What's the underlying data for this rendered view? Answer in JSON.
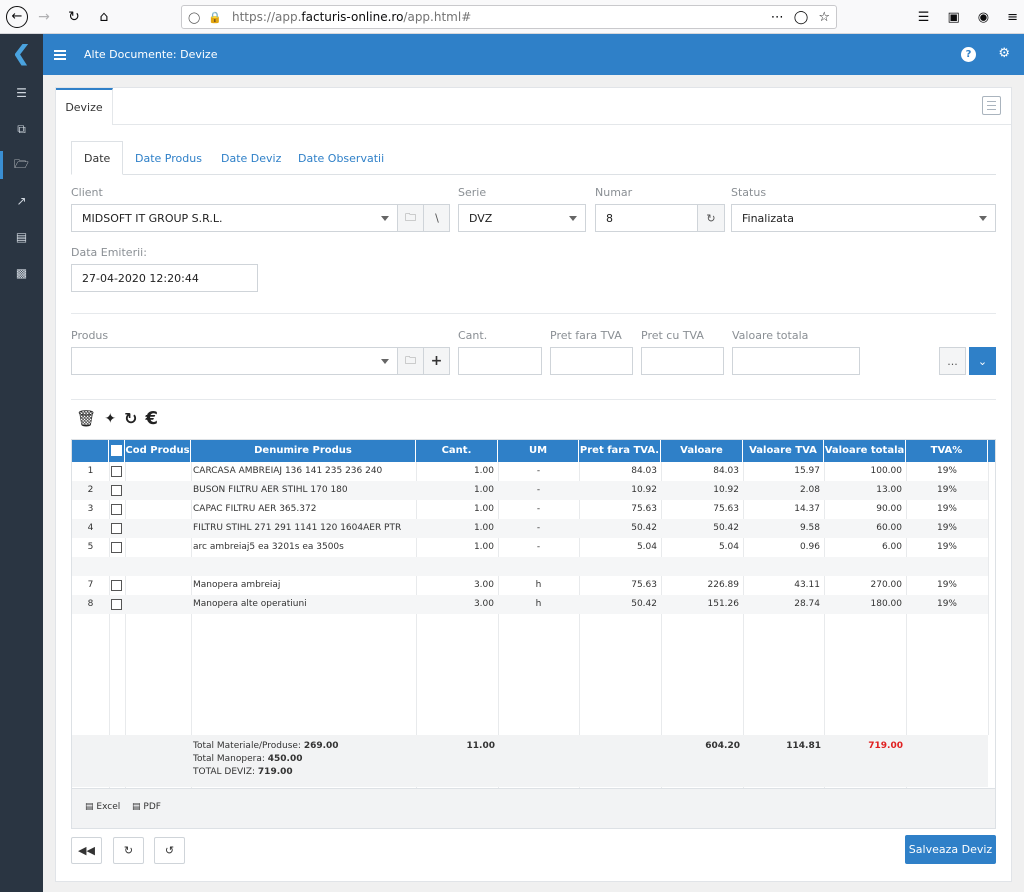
{
  "browser": {
    "url_prefix": "https://app.",
    "url_domain": "facturis-online.ro",
    "url_suffix": "/app.html#"
  },
  "header": {
    "title": "Alte Documente: Devize"
  },
  "doc_tab": "Devize",
  "tabs": [
    {
      "label": "Date"
    },
    {
      "label": "Date Produs"
    },
    {
      "label": "Date Deviz"
    },
    {
      "label": "Date Observatii"
    }
  ],
  "form": {
    "client_label": "Client",
    "client_value": "MIDSOFT IT GROUP S.R.L.",
    "serie_label": "Serie",
    "serie_value": "DVZ",
    "numar_label": "Numar",
    "numar_value": "8",
    "status_label": "Status",
    "status_value": "Finalizata",
    "data_label": "Data Emiterii:",
    "data_value": "27-04-2020 12:20:44"
  },
  "product_form": {
    "produs_label": "Produs",
    "cant_label": "Cant.",
    "pret_fara_label": "Pret fara TVA",
    "pret_cu_label": "Pret cu TVA",
    "valoare_label": "Valoare totala",
    "more_label": "..."
  },
  "table": {
    "headers": [
      "Cod Produs",
      "Denumire Produs",
      "Cant.",
      "UM",
      "Pret fara TVA.",
      "Valoare",
      "Valoare TVA",
      "Valoare totala",
      "TVA%"
    ],
    "rows": [
      {
        "nr": "1",
        "name": "CARCASA AMBREIAJ 136 141 235 236 240",
        "cant": "1.00",
        "um": "-",
        "pret": "84.03",
        "val": "84.03",
        "tva": "15.97",
        "tot": "100.00",
        "pct": "19%"
      },
      {
        "nr": "2",
        "name": "BUSON FILTRU AER STIHL 170 180",
        "cant": "1.00",
        "um": "-",
        "pret": "10.92",
        "val": "10.92",
        "tva": "2.08",
        "tot": "13.00",
        "pct": "19%"
      },
      {
        "nr": "3",
        "name": "CAPAC FILTRU AER 365.372",
        "cant": "1.00",
        "um": "-",
        "pret": "75.63",
        "val": "75.63",
        "tva": "14.37",
        "tot": "90.00",
        "pct": "19%"
      },
      {
        "nr": "4",
        "name": "FILTRU  STIHL 271 291 1141 120 1604AER PTR",
        "cant": "1.00",
        "um": "-",
        "pret": "50.42",
        "val": "50.42",
        "tva": "9.58",
        "tot": "60.00",
        "pct": "19%"
      },
      {
        "nr": "5",
        "name": "arc ambreiaj5 ea 3201s ea 3500s",
        "cant": "1.00",
        "um": "-",
        "pret": "5.04",
        "val": "5.04",
        "tva": "0.96",
        "tot": "6.00",
        "pct": "19%"
      },
      {
        "nr": "",
        "name": "",
        "cant": "",
        "um": "",
        "pret": "",
        "val": "",
        "tva": "",
        "tot": "",
        "pct": ""
      },
      {
        "nr": "7",
        "name": "Manopera ambreiaj",
        "cant": "3.00",
        "um": "h",
        "pret": "75.63",
        "val": "226.89",
        "tva": "43.11",
        "tot": "270.00",
        "pct": "19%"
      },
      {
        "nr": "8",
        "name": "Manopera alte operatiuni",
        "cant": "3.00",
        "um": "h",
        "pret": "50.42",
        "val": "151.26",
        "tva": "28.74",
        "tot": "180.00",
        "pct": "19%"
      }
    ],
    "totals": {
      "materiale_label": "Total Materiale/Produse:",
      "materiale_value": "269.00",
      "manopera_label": "Total Manopera:",
      "manopera_value": "450.00",
      "deviz_label": "TOTAL DEVIZ:",
      "deviz_value": "719.00",
      "cant": "11.00",
      "valoare": "604.20",
      "valoare_tva": "114.81",
      "valoare_totala": "719.00"
    },
    "export": {
      "excel": "Excel",
      "pdf": "PDF"
    }
  },
  "save_label": "Salveaza Deviz",
  "colors": {
    "accent": "#2f80c8",
    "sidebar": "#2a3542",
    "total_red": "#e02020"
  }
}
